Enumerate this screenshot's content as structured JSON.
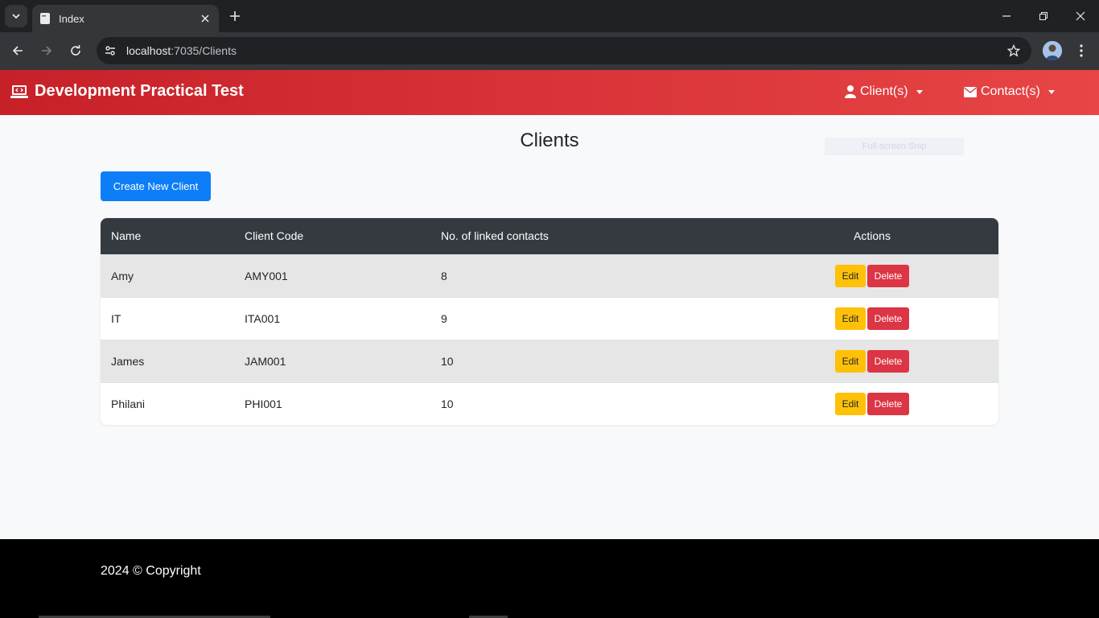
{
  "browser": {
    "tab_title": "Index",
    "url_host": "localhost",
    "url_rest": ":7035/Clients"
  },
  "navbar": {
    "brand": "Development Practical Test",
    "clients_menu": "Client(s)",
    "contacts_menu": "Contact(s)",
    "accent_color": "#d9353a"
  },
  "page": {
    "title": "Clients",
    "snip_overlay": "Full-screen Snip",
    "create_button": "Create New Client"
  },
  "table": {
    "headers": {
      "name": "Name",
      "code": "Client Code",
      "contacts": "No. of linked contacts",
      "actions": "Actions"
    },
    "edit_label": "Edit",
    "delete_label": "Delete",
    "rows": [
      {
        "name": "Amy",
        "code": "AMY001",
        "contacts": "8"
      },
      {
        "name": "IT",
        "code": "ITA001",
        "contacts": "9"
      },
      {
        "name": "James",
        "code": "JAM001",
        "contacts": "10"
      },
      {
        "name": "Philani",
        "code": "PHI001",
        "contacts": "10"
      }
    ]
  },
  "footer": {
    "text": "2024 © Copyright"
  }
}
